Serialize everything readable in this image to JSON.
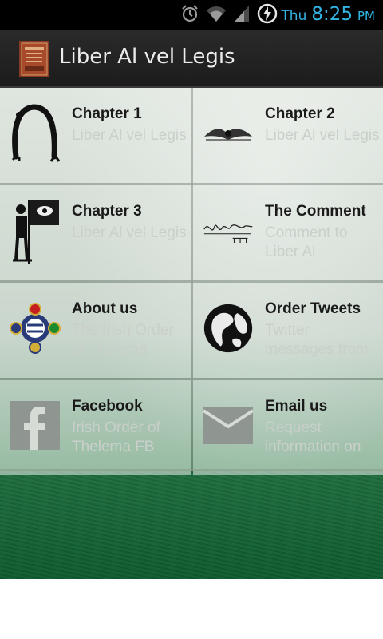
{
  "status_bar": {
    "day": "Thu",
    "time": "8:25",
    "ampm": "PM",
    "icons": [
      "alarm-icon",
      "wifi-icon",
      "signal-icon",
      "battery-charging-icon"
    ],
    "accent_color": "#33b5e5"
  },
  "action_bar": {
    "title": "Liber Al vel Legis",
    "icon": "book-cover-icon"
  },
  "tiles": [
    {
      "title": "Chapter 1",
      "subtitle": "Liber Al vel Legis",
      "icon": "nuit-figure-icon"
    },
    {
      "title": "Chapter 2",
      "subtitle": "Liber Al vel Legis",
      "icon": "winged-disk-icon"
    },
    {
      "title": "Chapter 3",
      "subtitle": "Liber Al vel Legis",
      "icon": "ra-hoor-khuit-icon"
    },
    {
      "title": "The Comment",
      "subtitle": "Comment to Liber Al",
      "icon": "handwritten-signature-icon"
    },
    {
      "title": "About us",
      "subtitle": "The Irish Order of Thelema",
      "icon": "order-crest-icon"
    },
    {
      "title": "Order Tweets",
      "subtitle": "Twitter messages from",
      "icon": "globe-emblem-icon"
    },
    {
      "title": "Facebook",
      "subtitle": "Irish Order of Thelema FB",
      "icon": "facebook-icon"
    },
    {
      "title": "Email us",
      "subtitle": "Request information on",
      "icon": "envelope-icon"
    }
  ]
}
